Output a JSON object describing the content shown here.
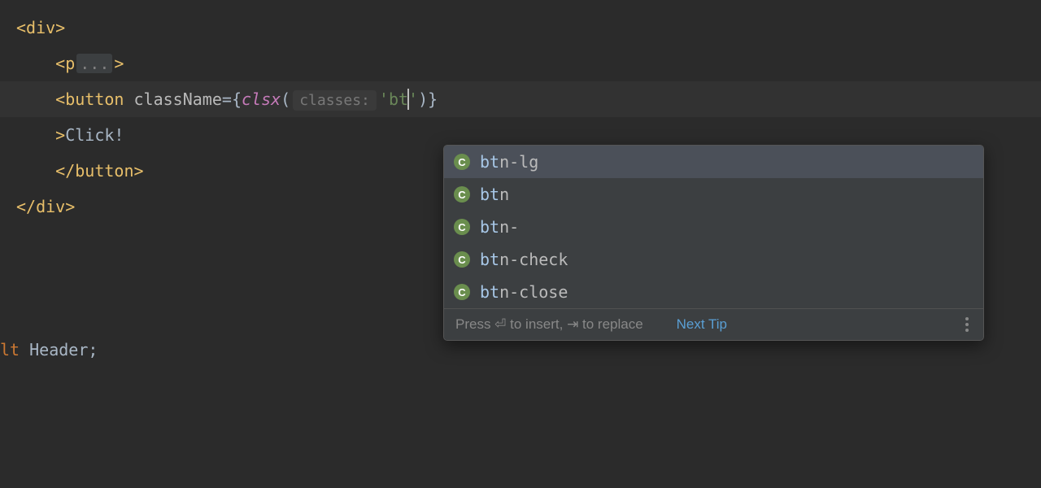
{
  "code": {
    "line1": {
      "open": "<",
      "tag": "div",
      "close": ">"
    },
    "line2": {
      "indent": "    ",
      "open": "<",
      "tag": "p",
      "fold": "...",
      "close": ">"
    },
    "line3": {
      "indent": "    ",
      "open": "<",
      "tag": "button",
      "space": " ",
      "attr": "className",
      "eq": "=",
      "brace_open": "{",
      "func": "clsx",
      "paren_open": "(",
      "param_hint": "classes:",
      "str_open": "'",
      "str_typed": "bt",
      "str_rest": "'",
      "paren_close": ")",
      "brace_close": "}"
    },
    "line4": {
      "indent": "    ",
      "close_tag": ">",
      "text": "Click!"
    },
    "line5": {
      "indent": "    ",
      "open": "</",
      "tag": "button",
      "close": ">"
    },
    "line6": {
      "open": "</",
      "tag": "div",
      "close": ">"
    },
    "line8": {
      "prefix": "lt ",
      "ident": "Header",
      "semi": ";"
    }
  },
  "autocomplete": {
    "items": [
      {
        "icon": "C",
        "match": "bt",
        "rest": "n-lg",
        "selected": true
      },
      {
        "icon": "C",
        "match": "bt",
        "rest": "n",
        "selected": false
      },
      {
        "icon": "C",
        "match": "bt",
        "rest": "n-",
        "selected": false
      },
      {
        "icon": "C",
        "match": "bt",
        "rest": "n-check",
        "selected": false
      },
      {
        "icon": "C",
        "match": "bt",
        "rest": "n-close",
        "selected": false
      }
    ],
    "footer_hint": "Press ⏎ to insert, ⇥ to replace",
    "footer_link": "Next Tip"
  }
}
